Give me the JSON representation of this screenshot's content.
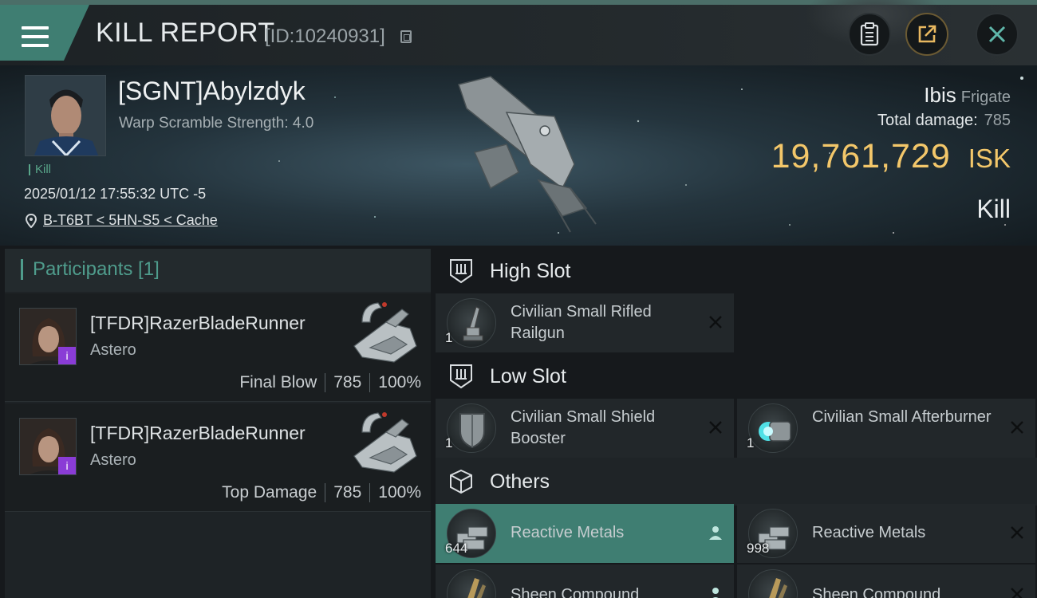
{
  "header": {
    "title": "KILL REPORT",
    "report_id": "[ID:10240931]"
  },
  "victim": {
    "name": "[SGNT]Abylzdyk",
    "warp_scramble": "Warp Scramble Strength: 4.0",
    "tag": "Kill",
    "datetime": "2025/01/12 17:55:32 UTC -5",
    "location": "B-T6BT < 5HN-S5 < Cache",
    "ship_name": "Ibis",
    "ship_class": "Frigate",
    "total_damage_label": "Total damage:",
    "total_damage": "785",
    "isk_value": "19,761,729",
    "isk_unit": "ISK",
    "result": "Kill"
  },
  "participants": {
    "header": "Participants [1]",
    "items": [
      {
        "name": "[TFDR]RazerBladeRunner",
        "ship": "Astero",
        "role": "Final Blow",
        "damage": "785",
        "percent": "100%",
        "badge": "i"
      },
      {
        "name": "[TFDR]RazerBladeRunner",
        "ship": "Astero",
        "role": "Top Damage",
        "damage": "785",
        "percent": "100%",
        "badge": "i"
      }
    ]
  },
  "fitting": {
    "high_slot": {
      "label": "High Slot",
      "items": [
        {
          "name": "Civilian Small Rifled Railgun",
          "qty": "1",
          "icon": "railgun-icon"
        }
      ]
    },
    "low_slot": {
      "label": "Low Slot",
      "items": [
        {
          "name": "Civilian Small Shield Booster",
          "qty": "1",
          "icon": "shield-booster-icon"
        },
        {
          "name": "Civilian Small Afterburner",
          "qty": "1",
          "icon": "afterburner-icon"
        }
      ]
    },
    "others": {
      "label": "Others",
      "items": [
        {
          "name": "Reactive Metals",
          "qty": "644",
          "icon": "reactive-metals-icon",
          "highlighted": true,
          "action": "person-icon"
        },
        {
          "name": "Reactive Metals",
          "qty": "998",
          "icon": "reactive-metals-icon",
          "highlighted": false,
          "action": "close-icon"
        },
        {
          "name": "Sheen Compound",
          "qty": "",
          "icon": "sheen-compound-icon",
          "highlighted": false
        },
        {
          "name": "Sheen Compound",
          "qty": "",
          "icon": "sheen-compound-icon",
          "highlighted": false
        }
      ]
    }
  },
  "colors": {
    "accent": "#3f7e72",
    "isk": "#f3c76a",
    "kill_tag": "#59a68a",
    "badge": "#8a3cd6"
  }
}
